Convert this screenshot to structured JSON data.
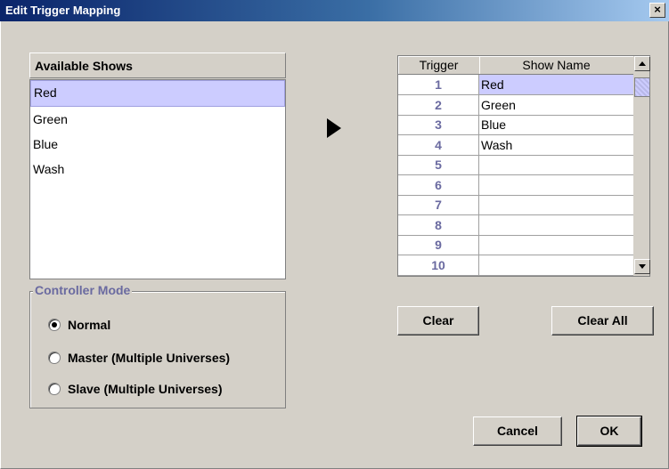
{
  "window": {
    "title": "Edit Trigger Mapping",
    "close_glyph": "×"
  },
  "available_shows": {
    "header": "Available Shows",
    "items": [
      "Red",
      "Green",
      "Blue",
      "Wash"
    ],
    "selected_index": 0
  },
  "controller_mode": {
    "title": "Controller Mode",
    "options": [
      "Normal",
      "Master (Multiple Universes)",
      "Slave (Multiple Universes)"
    ],
    "selected_index": 0
  },
  "trigger_table": {
    "columns": [
      "Trigger",
      "Show Name"
    ],
    "rows": [
      {
        "trigger": "1",
        "show": "Red"
      },
      {
        "trigger": "2",
        "show": "Green"
      },
      {
        "trigger": "3",
        "show": "Blue"
      },
      {
        "trigger": "4",
        "show": "Wash"
      },
      {
        "trigger": "5",
        "show": ""
      },
      {
        "trigger": "6",
        "show": ""
      },
      {
        "trigger": "7",
        "show": ""
      },
      {
        "trigger": "8",
        "show": ""
      },
      {
        "trigger": "9",
        "show": ""
      },
      {
        "trigger": "10",
        "show": ""
      }
    ],
    "selected_index": 0
  },
  "buttons": {
    "clear": "Clear",
    "clear_all": "Clear All",
    "cancel": "Cancel",
    "ok": "OK"
  },
  "colors": {
    "selection": "#ccccff",
    "title_bar": "#0a246a",
    "accent_text": "#6a6aa0"
  }
}
